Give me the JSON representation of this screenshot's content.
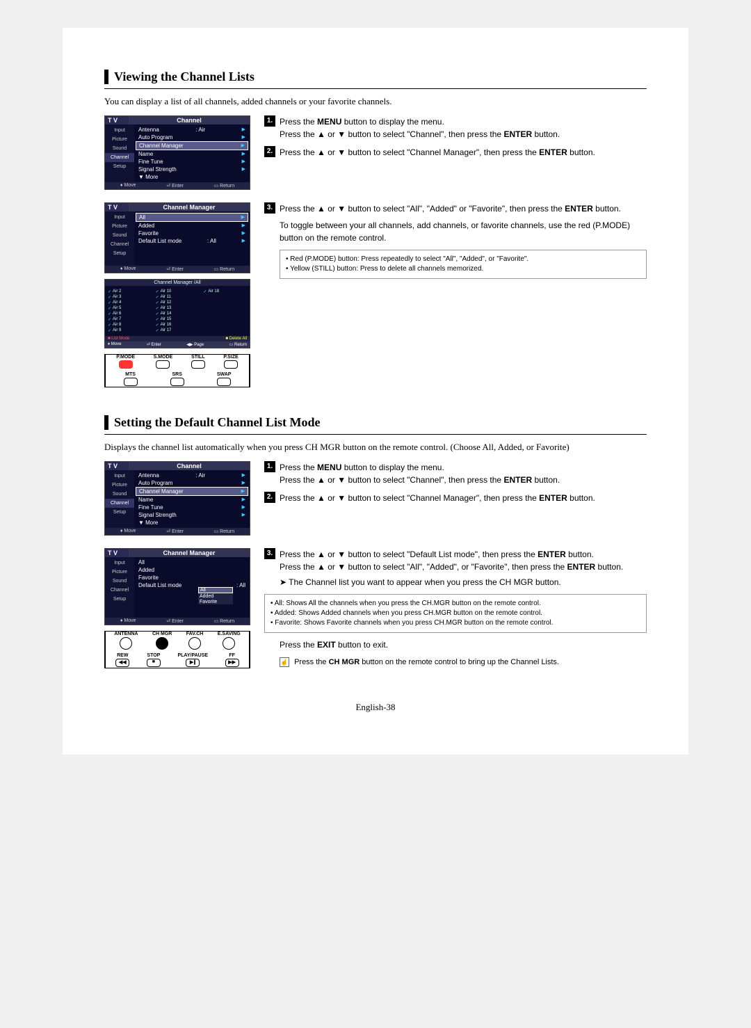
{
  "page_number": "English-38",
  "section1": {
    "title": "Viewing the Channel Lists",
    "intro": "You can display a list of all channels, added channels or your favorite channels.",
    "steps": {
      "s1a": "Press the ",
      "s1_menu": "MENU",
      "s1b": " button to display the menu.",
      "s1c": "Press the ▲ or ▼ button to select \"Channel\", then press the ",
      "s1_enter": "ENTER",
      "s1d": " button.",
      "s2a": "Press the ▲ or ▼ button to select \"Channel Manager\", then press the ",
      "s2_enter": "ENTER",
      "s2b": " button.",
      "s3a": "Press the ▲ or ▼ button to select \"All\", \"Added\" or \"Favorite\", then press the ",
      "s3_enter": "ENTER",
      "s3b": " button.",
      "s3c": "To toggle between your all channels, add channels, or favorite channels, use the red (P.MODE) button on the remote control."
    },
    "notes": {
      "n1": "• Red (P.MODE) button: Press repeatedly to select \"All\", \"Added\", or \"Favorite\".",
      "n2": "• Yellow (STILL) button: Press to delete all channels memorized."
    },
    "menu1": {
      "tv": "T V",
      "title": "Channel",
      "side": [
        "Input",
        "Picture",
        "Sound",
        "Channel",
        "Setup"
      ],
      "antenna_label": "Antenna",
      "antenna_val": ": Air",
      "auto_program": "Auto Program",
      "channel_manager": "Channel Manager",
      "name": "Name",
      "fine_tune": "Fine Tune",
      "signal_strength": "Signal Strength",
      "more": "▼ More",
      "footer_move": "Move",
      "footer_enter": "Enter",
      "footer_return": "Return"
    },
    "menu2": {
      "tv": "T V",
      "title": "Channel Manager",
      "side": [
        "Input",
        "Picture",
        "Sound",
        "Channel",
        "Setup"
      ],
      "all": "All",
      "added": "Added",
      "favorite": "Favorite",
      "default_list_mode": "Default List mode",
      "default_list_val": ": All",
      "footer_move": "Move",
      "footer_enter": "Enter",
      "footer_return": "Return"
    },
    "chgrid": {
      "title": "Channel Manager /All",
      "col1": [
        "Air 2",
        "Air 3",
        "Air 4",
        "Air 5",
        "Air 6",
        "Air 7",
        "Air 8",
        "Air 9"
      ],
      "col2": [
        "Air 10",
        "Air 11",
        "Air 12",
        "Air 13",
        "Air 14",
        "Air 15",
        "Air 16",
        "Air 17"
      ],
      "col3": [
        "Air 18"
      ],
      "footer_list": "List Mode",
      "footer_delete": "Delete All",
      "footer2_move": "Move",
      "footer2_enter": "Enter",
      "footer2_page": "Page",
      "footer2_return": "Return"
    },
    "remote1": {
      "row1": [
        "P.MODE",
        "S.MODE",
        "STILL",
        "P.SIZE"
      ],
      "row2": [
        "MTS",
        "SRS",
        "SWAP"
      ]
    }
  },
  "section2": {
    "title": "Setting the Default Channel List Mode",
    "intro": "Displays the channel list automatically when you press CH MGR button on the remote control. (Choose All, Added, or Favorite)",
    "steps": {
      "s1a": "Press the ",
      "s1_menu": "MENU",
      "s1b": " button to display the menu.",
      "s1c": "Press the ▲ or ▼ button to select \"Channel\", then press the ",
      "s1_enter": "ENTER",
      "s1d": " button.",
      "s2a": "Press the ▲ or ▼ button to select \"Channel Manager\", then press the ",
      "s2_enter": "ENTER",
      "s2b": " button.",
      "s3a": "Press the ▲ or ▼ button to select \"Default List mode\", then press the ",
      "s3_enter1": "ENTER",
      "s3b": " button.",
      "s3c": "Press the ▲ or ▼ button to select \"All\", \"Added\", or \"Favorite\", then press the ",
      "s3_enter2": "ENTER",
      "s3d": " button.",
      "s3_arrow": "➤  The Channel list you want to appear when you press the CH MGR button."
    },
    "bullets": {
      "b1": "• All: Shows All the channels when you press the CH.MGR button on the remote control.",
      "b2": "• Added: Shows Added channels when you press CH.MGR button on the remote control.",
      "b3": "• Favorite: Shows Favorite channels when you press CH.MGR button on the remote control."
    },
    "exit_a": "Press the ",
    "exit_b": "EXIT",
    "exit_c": " button to exit.",
    "chmgr_note_a": "Press the ",
    "chmgr_note_b": "CH MGR",
    "chmgr_note_c": " button on the remote control to bring up the Channel Lists.",
    "menu1": {
      "tv": "T V",
      "title": "Channel",
      "side": [
        "Input",
        "Picture",
        "Sound",
        "Channel",
        "Setup"
      ],
      "antenna_label": "Antenna",
      "antenna_val": ": Air",
      "auto_program": "Auto Program",
      "channel_manager": "Channel Manager",
      "name": "Name",
      "fine_tune": "Fine Tune",
      "signal_strength": "Signal Strength",
      "more": "▼ More",
      "footer_move": "Move",
      "footer_enter": "Enter",
      "footer_return": "Return"
    },
    "menu2": {
      "tv": "T V",
      "title": "Channel Manager",
      "side": [
        "Input",
        "Picture",
        "Sound",
        "Channel",
        "Setup"
      ],
      "all": "All",
      "added": "Added",
      "favorite": "Favorite",
      "default_list_mode": "Default List mode",
      "default_list_val": ": All",
      "dd_all": "All",
      "dd_added": "Added",
      "dd_favorite": "Favorite",
      "footer_move": "Move",
      "footer_enter": "Enter",
      "footer_return": "Return"
    },
    "remote2": {
      "row1": [
        "ANTENNA",
        "CH MGR",
        "FAV.CH",
        "E.SAVING"
      ],
      "row2": [
        "REW",
        "STOP",
        "PLAY/PAUSE",
        "FF"
      ]
    }
  }
}
